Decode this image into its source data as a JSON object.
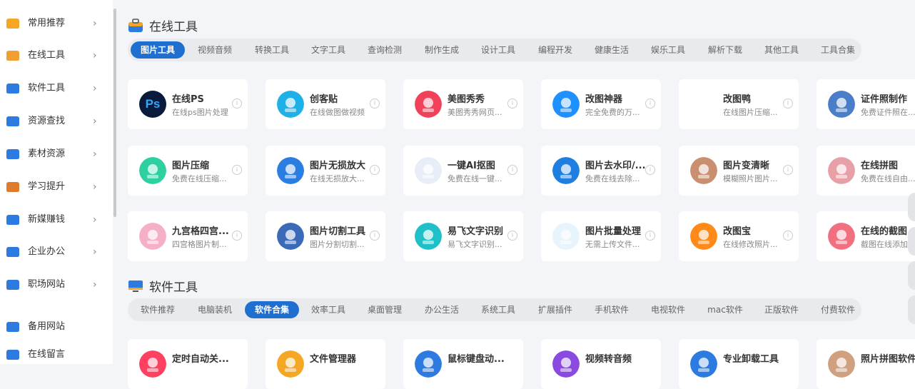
{
  "sidebar": {
    "items": [
      {
        "label": "常用推荐",
        "icon": "thumbs-up-icon",
        "color": "#f5a623"
      },
      {
        "label": "在线工具",
        "icon": "toolbox-icon",
        "color": "#f0a030"
      },
      {
        "label": "软件工具",
        "icon": "monitor-icon",
        "color": "#2d7be0"
      },
      {
        "label": "资源查找",
        "icon": "search-doc-icon",
        "color": "#2d7be0"
      },
      {
        "label": "素材资源",
        "icon": "image-icon",
        "color": "#2d7be0"
      },
      {
        "label": "学习提升",
        "icon": "student-icon",
        "color": "#e07a2d"
      },
      {
        "label": "新媒赚钱",
        "icon": "pie-chart-icon",
        "color": "#2d7be0"
      },
      {
        "label": "企业办公",
        "icon": "office-icon",
        "color": "#2d7be0"
      },
      {
        "label": "职场网站",
        "icon": "people-icon",
        "color": "#2d7be0"
      },
      {
        "label": "备用网站",
        "icon": "gear-icon",
        "color": "#2d7be0"
      },
      {
        "label": "在线留言",
        "icon": "chat-icon",
        "color": "#2d7be0"
      }
    ]
  },
  "online_tools": {
    "title": "在线工具",
    "tabs": [
      "图片工具",
      "视频音频",
      "转换工具",
      "文字工具",
      "查询检测",
      "制作生成",
      "设计工具",
      "编程开发",
      "健康生活",
      "娱乐工具",
      "解析下载",
      "其他工具",
      "工具合集"
    ],
    "active_tab": 0,
    "cards": [
      {
        "title": "在线PS",
        "desc": "在线ps图片处理",
        "icon": "ps-icon",
        "color": "#0a1a3a",
        "glyph": "Ps",
        "glyph_color": "#31a8ff"
      },
      {
        "title": "创客贴",
        "desc": "在线做图做视频",
        "icon": "chuangketie-icon",
        "color": "#1fb0e8",
        "glyph": "",
        "glyph_color": "#fff"
      },
      {
        "title": "美图秀秀",
        "desc": "美图秀秀网页...",
        "icon": "meitu-icon",
        "color": "#f0405a",
        "glyph": "",
        "glyph_color": "#fff"
      },
      {
        "title": "改图神器",
        "desc": "完全免费的万...",
        "icon": "gaitu-icon",
        "color": "#1e90ff",
        "glyph": "",
        "glyph_color": "#fff"
      },
      {
        "title": "改图鸭",
        "desc": "在线图片压缩...",
        "icon": "gaituya-icon",
        "color": "#ffffff",
        "glyph": "",
        "glyph_color": "#333"
      },
      {
        "title": "证件照制作",
        "desc": "免费证件照在...",
        "icon": "id-photo-icon",
        "color": "#4a7ec8",
        "glyph": "",
        "glyph_color": "#fff"
      },
      {
        "title": "图片压缩",
        "desc": "免费在线压缩...",
        "icon": "compress-icon",
        "color": "#2ecfa0",
        "glyph": "",
        "glyph_color": "#fff"
      },
      {
        "title": "图片无损放大",
        "desc": "在线无损放大...",
        "icon": "doraemon-icon",
        "color": "#2a7de1",
        "glyph": "",
        "glyph_color": "#fff"
      },
      {
        "title": "一键AI抠图",
        "desc": "免费在线一键...",
        "icon": "ai-cutout-icon",
        "color": "#e8eef7",
        "glyph": "",
        "glyph_color": "#fff"
      },
      {
        "title": "图片去水印/...",
        "desc": "免费在线去除...",
        "icon": "watermark-icon",
        "color": "#1e7fe0",
        "glyph": "",
        "glyph_color": "#fff"
      },
      {
        "title": "图片变清晰",
        "desc": "模糊照片图片...",
        "icon": "enhance-icon",
        "color": "#c89070",
        "glyph": "",
        "glyph_color": "#fff"
      },
      {
        "title": "在线拼图",
        "desc": "免费在线自由...",
        "icon": "collage-icon",
        "color": "#e8a0a8",
        "glyph": "",
        "glyph_color": "#fff"
      },
      {
        "title": "九宫格四宫...",
        "desc": "四宫格图片制...",
        "icon": "grid-icon",
        "color": "#f5b0c8",
        "glyph": "",
        "glyph_color": "#fff"
      },
      {
        "title": "图片切割工具",
        "desc": "图片分割切割...",
        "icon": "cut-icon",
        "color": "#3a6ab8",
        "glyph": "",
        "glyph_color": "#fff"
      },
      {
        "title": "易飞文字识别",
        "desc": "易飞文字识别...",
        "icon": "ocr-icon",
        "color": "#1fc0c8",
        "glyph": "",
        "glyph_color": "#fff"
      },
      {
        "title": "图片批量处理",
        "desc": "无需上传文件...",
        "icon": "batch-icon",
        "color": "#e8f4fb",
        "glyph": "",
        "glyph_color": "#fff"
      },
      {
        "title": "改图宝",
        "desc": "在线修改照片...",
        "icon": "gaitubao-icon",
        "color": "#ff8a1a",
        "glyph": "",
        "glyph_color": "#fff"
      },
      {
        "title": "在线的截图...",
        "desc": "截图在线添加...",
        "icon": "screenshot-icon",
        "color": "#f07080",
        "glyph": "",
        "glyph_color": "#fff"
      }
    ]
  },
  "software_tools": {
    "title": "软件工具",
    "tabs": [
      "软件推荐",
      "电脑装机",
      "软件合集",
      "效率工具",
      "桌面管理",
      "办公生活",
      "系统工具",
      "扩展插件",
      "手机软件",
      "电视软件",
      "mac软件",
      "正版软件",
      "付费软件"
    ],
    "active_tab": 2,
    "cards": [
      {
        "title": "定时自动关...",
        "icon": "power-icon",
        "color": "#ff4060"
      },
      {
        "title": "文件管理器",
        "icon": "folder-icon",
        "color": "#f5a623"
      },
      {
        "title": "鼠标键盘动...",
        "icon": "mouse-icon",
        "color": "#2d7be0"
      },
      {
        "title": "视频转音频",
        "icon": "convert-icon",
        "color": "#8a4adf"
      },
      {
        "title": "专业卸载工具",
        "icon": "uninstall-icon",
        "color": "#2d7be0"
      },
      {
        "title": "照片拼图软件",
        "icon": "photo-puzzle-icon",
        "color": "#d0a080"
      }
    ]
  }
}
